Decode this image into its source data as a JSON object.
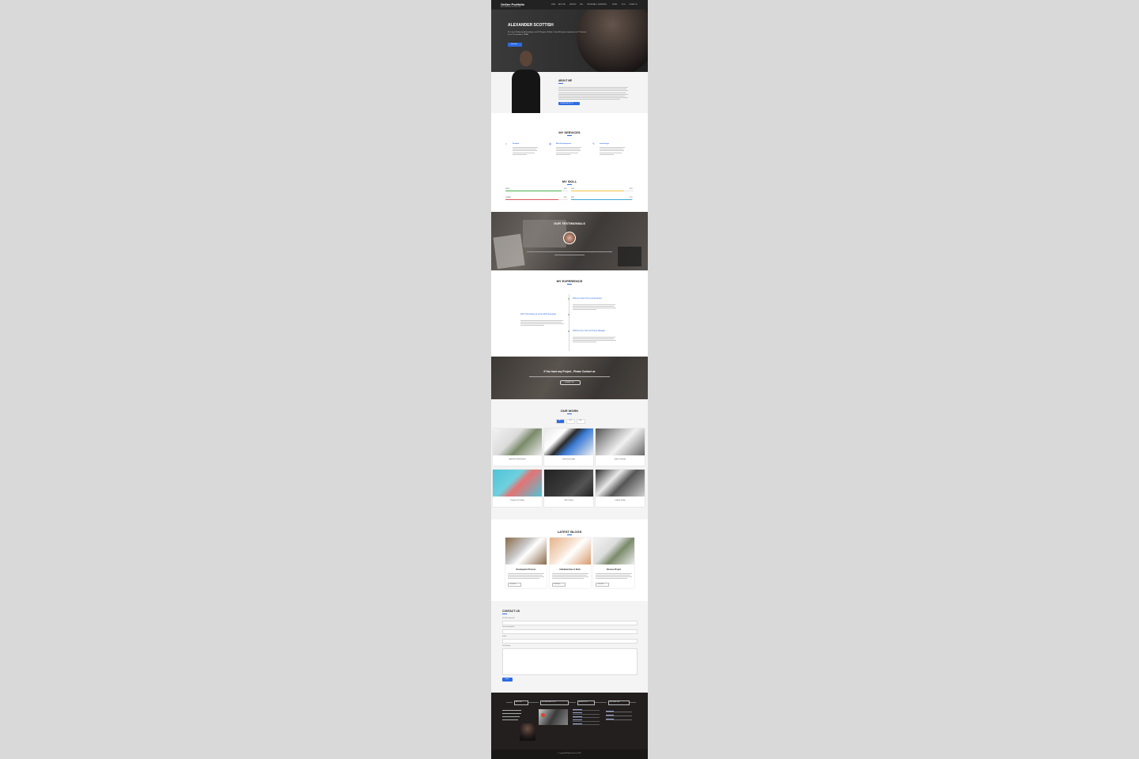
{
  "brand": {
    "name": "Online Portfolio",
    "tagline": "your awesome one liner sub"
  },
  "nav": [
    "HOME",
    "ABOUT ME",
    "SERVICES",
    "SKILL",
    "TESTIMONIALS",
    "EXPERIENCE",
    "WORKS",
    "BLOG",
    "CONTACT US"
  ],
  "hero": {
    "name": "ALEXANDER SCOTTISH",
    "intro": "Hi, I am a Professional Developer, and UI Progress Folder. I have Rich years experience in IT Services as an IT consultant, 100Ali.",
    "button": "Hire Me"
  },
  "about": {
    "title": "ABOUT ME",
    "button": "DOWNLOAD MY CV"
  },
  "services": {
    "title": "MY SERVICES",
    "items": [
      {
        "name": "Product",
        "icon": "home-icon"
      },
      {
        "name": "Web Development",
        "icon": "globe-icon"
      },
      {
        "name": "web design",
        "icon": "pencil-icon"
      }
    ]
  },
  "skills": {
    "title": "MY SKILL",
    "items": [
      {
        "name": "HTML",
        "percent": 90,
        "label": "90%",
        "color": "#4caf50"
      },
      {
        "name": "CSS",
        "percent": 85,
        "label": "85%",
        "color": "#f6c343"
      },
      {
        "name": "JQUERY",
        "percent": 85,
        "label": "85%",
        "color": "#e05a5a"
      },
      {
        "name": "PHP",
        "percent": 97,
        "label": "97%",
        "color": "#3fa9d6"
      }
    ]
  },
  "testimonials": {
    "title": "OUR TESTIMONIALS"
  },
  "experience": {
    "title": "MY EXPERIENCE",
    "items": [
      {
        "title": "2014 as Junior front end developer",
        "side": "right"
      },
      {
        "title": "2017 Technology as senior ECH developer",
        "side": "left"
      },
      {
        "title": "2018 Go Ken Tech as Project Manager",
        "side": "right"
      }
    ]
  },
  "cta": {
    "title": "If You have any Project , Please Contact us",
    "button": "CONTACT US"
  },
  "work": {
    "title": "OUR WORK",
    "filters": [
      "All",
      "Web",
      "App"
    ],
    "items": [
      {
        "label": "application development"
      },
      {
        "label": "marketing manage"
      },
      {
        "label": "project manager"
      },
      {
        "label": "Responsive Design"
      },
      {
        "label": "Web Coding"
      },
      {
        "label": "website design"
      }
    ]
  },
  "blogs": {
    "title": "LATEST BLOGS",
    "items": [
      {
        "title": "Development Process",
        "button": "Read More"
      },
      {
        "title": "Individual How to Work",
        "button": "Read More"
      },
      {
        "title": "Discuss Project",
        "button": "Read More"
      }
    ]
  },
  "contact": {
    "title": "CONTACT US",
    "fields": [
      "Your Name (required)",
      "Your Email (required)",
      "Subject",
      "Your Message"
    ],
    "button": "Send"
  },
  "footer": {
    "headings": [
      "ABOUT ME",
      "POPULAR LATEST POST",
      "RECENT POST",
      "IMPORTANT LINK"
    ],
    "copyright": "© Copyright All Rights Reserved 2017"
  }
}
